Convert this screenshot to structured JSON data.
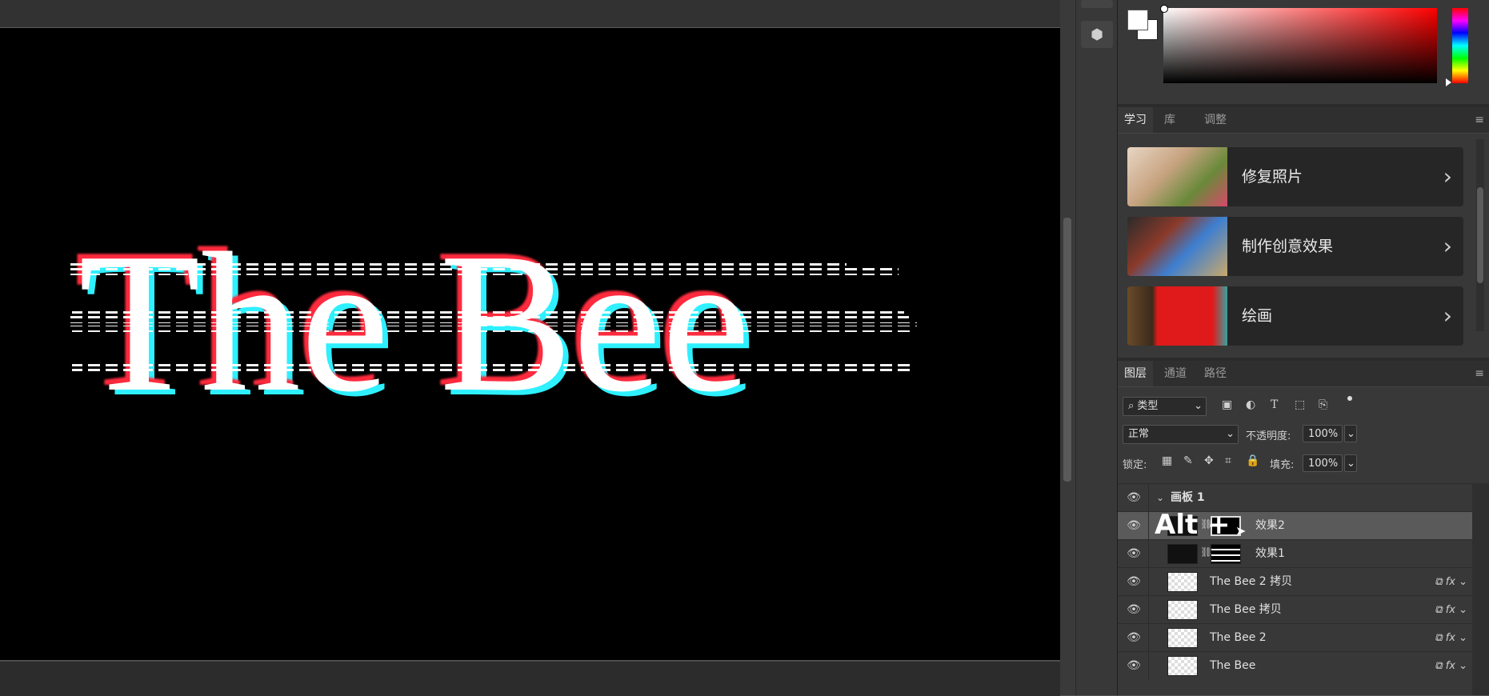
{
  "canvas": {
    "artwork_text": "The Bee"
  },
  "learn_panel": {
    "tabs": [
      "学习",
      "库",
      "调整"
    ],
    "cards": [
      {
        "label": "修复照片"
      },
      {
        "label": "制作创意效果"
      },
      {
        "label": "绘画"
      }
    ]
  },
  "layers_panel": {
    "tabs": [
      "图层",
      "通道",
      "路径"
    ],
    "filter_kind": "类型",
    "blend_mode": "正常",
    "opacity_label": "不透明度:",
    "opacity_value": "100%",
    "lock_label": "锁定:",
    "fill_label": "填充:",
    "fill_value": "100%",
    "group_name": "画板 1",
    "layers": [
      {
        "name": "效果2",
        "selected": true
      },
      {
        "name": "效果1",
        "selected": false
      },
      {
        "name": "The Bee 2 拷贝",
        "fx": "fx"
      },
      {
        "name": "The Bee 拷贝",
        "fx": "fx"
      },
      {
        "name": "The Bee 2",
        "fx": "fx"
      },
      {
        "name": "The Bee",
        "fx": "fx"
      }
    ],
    "overlay_hint": "Alt +"
  },
  "colors": {
    "canvas_bg": "#000000",
    "panel_bg": "#383838",
    "selected_row": "#5a5a5a",
    "glitch_red": "#ff2b3c",
    "glitch_cyan": "#2ef0ff"
  }
}
